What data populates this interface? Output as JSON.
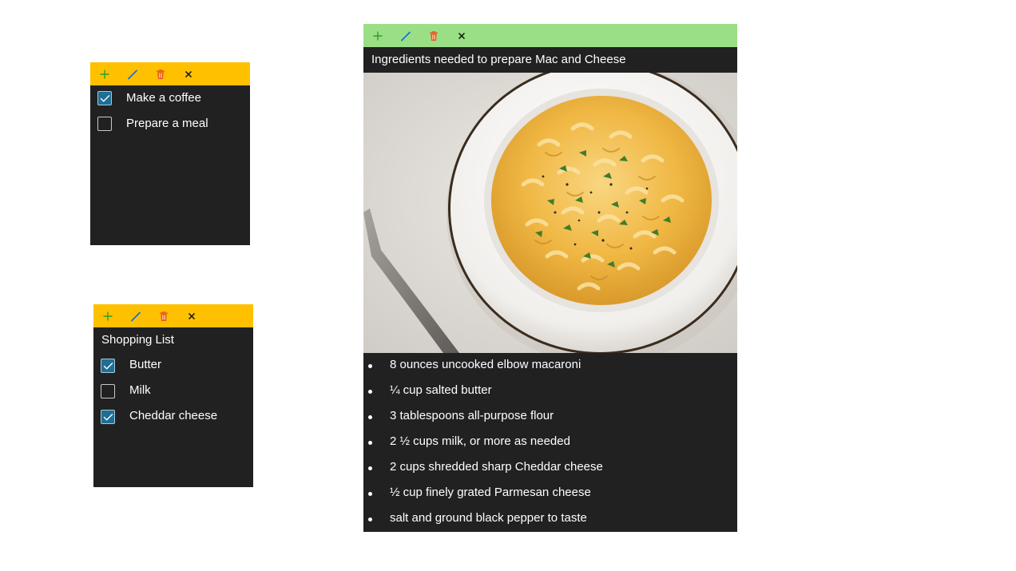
{
  "colors": {
    "yellow_toolbar": "#FFC000",
    "green_toolbar": "#9ADF86",
    "note_background": "#212121",
    "checkbox_checked": "#1F6E96",
    "add_icon": "#2E9E2E",
    "edit_icon": "#1E6FD9",
    "delete_icon": "#E8581C",
    "close_icon": "#111111"
  },
  "toolbar_icons": [
    "plus-icon",
    "pencil-icon",
    "trash-icon",
    "close-icon"
  ],
  "todo_note": {
    "items": [
      {
        "label": "Make a coffee",
        "checked": true
      },
      {
        "label": "Prepare a meal",
        "checked": false
      }
    ]
  },
  "shopping_note": {
    "title": "Shopping List",
    "items": [
      {
        "label": "Butter",
        "checked": true
      },
      {
        "label": "Milk",
        "checked": false
      },
      {
        "label": "Cheddar cheese",
        "checked": true
      }
    ]
  },
  "recipe_note": {
    "title": "Ingredients needed to prepare Mac and Cheese",
    "image_subject": "Bowl of mac and cheese",
    "ingredients": [
      "8 ounces uncooked elbow macaroni",
      "¼ cup salted butter",
      "3 tablespoons all-purpose flour",
      "2 ½ cups milk, or more as needed",
      "2 cups shredded sharp Cheddar cheese",
      "½ cup finely grated Parmesan cheese",
      "salt and ground black pepper to taste"
    ]
  }
}
